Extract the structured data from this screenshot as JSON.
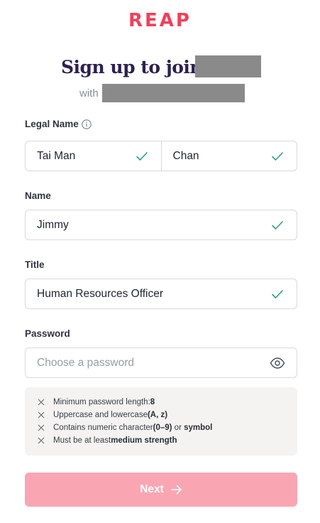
{
  "brand": {
    "logo_text": "REAP",
    "accent_color": "#f0405a",
    "check_color": "#2e9e86",
    "button_color": "#f9a6b2"
  },
  "header": {
    "title": "Sign up to join",
    "with_label": "with"
  },
  "legal_name": {
    "label": "Legal Name",
    "info_icon": "info-icon",
    "first_value": "Tai Man",
    "last_value": "Chan"
  },
  "name": {
    "label": "Name",
    "value": "Jimmy"
  },
  "title_field": {
    "label": "Title",
    "value": "Human Resources Officer"
  },
  "password": {
    "label": "Password",
    "placeholder": "Choose a password",
    "visibility_icon": "eye-icon",
    "rules": [
      {
        "prefix": "Minimum password length: ",
        "bold": "8",
        "mid": "",
        "bold2": ""
      },
      {
        "prefix": "Uppercase and lowercase ",
        "bold": "(A, z)",
        "mid": "",
        "bold2": ""
      },
      {
        "prefix": "Contains numeric character ",
        "bold": "(0–9)",
        "mid": " or ",
        "bold2": "symbol"
      },
      {
        "prefix": "Must be at least ",
        "bold": "medium strength",
        "mid": "",
        "bold2": ""
      }
    ]
  },
  "next_button": {
    "label": "Next"
  }
}
